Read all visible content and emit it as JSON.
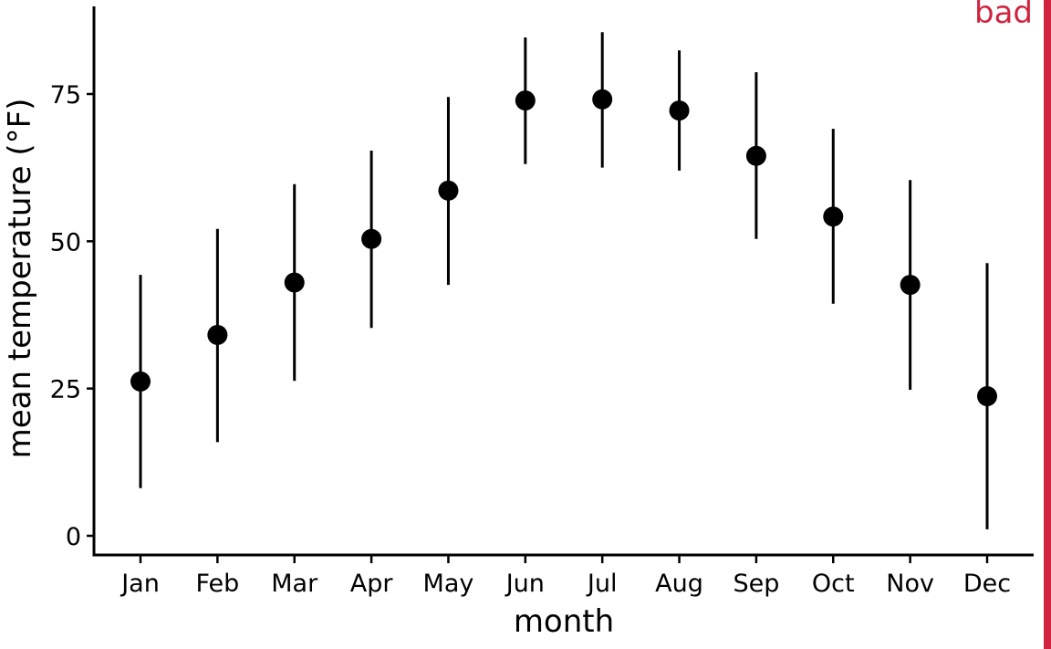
{
  "badge": {
    "label": "bad",
    "color": "#D1233F"
  },
  "chart_data": {
    "type": "scatter",
    "subtype": "pointrange",
    "title": "",
    "xlabel": "month",
    "ylabel": "mean temperature (°F)",
    "ylim": [
      -3.3,
      90
    ],
    "yticks": [
      0,
      25,
      50,
      75
    ],
    "grid": false,
    "legend": "none",
    "categories": [
      "Jan",
      "Feb",
      "Mar",
      "Apr",
      "May",
      "Jun",
      "Jul",
      "Aug",
      "Sep",
      "Oct",
      "Nov",
      "Dec"
    ],
    "series": [
      {
        "name": "mean temperature",
        "color": "#000000",
        "values": [
          26.2,
          34.1,
          43.0,
          50.4,
          58.6,
          73.9,
          74.1,
          72.2,
          64.5,
          54.2,
          42.6,
          23.7
        ],
        "lower": [
          8.1,
          15.9,
          26.3,
          35.3,
          42.6,
          63.1,
          62.5,
          62.0,
          50.4,
          39.4,
          24.8,
          1.1
        ],
        "upper": [
          44.3,
          52.1,
          59.7,
          65.4,
          74.5,
          84.6,
          85.5,
          82.4,
          78.7,
          69.1,
          60.4,
          46.3
        ]
      }
    ]
  }
}
